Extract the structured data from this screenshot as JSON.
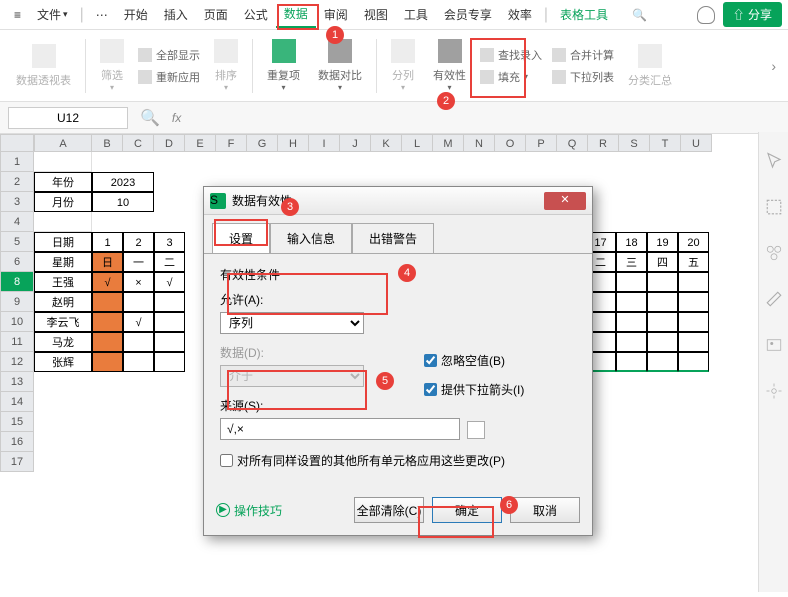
{
  "menubar": {
    "file": "文件",
    "items": [
      "开始",
      "插入",
      "页面",
      "公式",
      "数据",
      "审阅",
      "视图",
      "工具",
      "会员专享",
      "效率"
    ],
    "active_index": 4,
    "tools_label": "表格工具",
    "share": "分享"
  },
  "ribbon": {
    "pivot": "数据透视表",
    "filter": "筛选",
    "show_all": "全部显示",
    "reapply": "重新应用",
    "sort": "排序",
    "dup": "重复项",
    "compare": "数据对比",
    "split": "分列",
    "validity": "有效性",
    "fill": "填充",
    "find_input": "查找录入",
    "drop_list": "下拉列表",
    "consolidate": "合并计算",
    "cat_sum": "分类汇总"
  },
  "refbar": {
    "cell": "U12",
    "fx": "fx"
  },
  "columns": [
    "A",
    "B",
    "C",
    "D",
    "E",
    "F",
    "G",
    "H",
    "I",
    "J",
    "K",
    "L",
    "M",
    "N",
    "O",
    "P",
    "Q",
    "R",
    "S",
    "T",
    "U"
  ],
  "data_cols_right": [
    "17",
    "18",
    "19",
    "20"
  ],
  "weekday_right": [
    "二",
    "三",
    "四",
    "五"
  ],
  "sheet": {
    "r2": {
      "label": "年份",
      "value": "2023"
    },
    "r3": {
      "label": "月份",
      "value": "10"
    },
    "r5": {
      "label": "日期",
      "vals": [
        "1",
        "2",
        "3"
      ]
    },
    "r6": {
      "label": "星期",
      "vals": [
        "日",
        "一",
        "二"
      ]
    },
    "r8": {
      "label": "王强",
      "vals": [
        "√",
        "×",
        "√"
      ]
    },
    "r9": {
      "label": "赵明",
      "vals": [
        "",
        "",
        ""
      ]
    },
    "r10": {
      "label": "李云飞",
      "vals": [
        "",
        "√",
        ""
      ]
    },
    "r11": {
      "label": "马龙",
      "vals": [
        "",
        "",
        ""
      ]
    },
    "r12": {
      "label": "张辉",
      "vals": [
        "",
        "",
        ""
      ]
    }
  },
  "dialog": {
    "title": "数据有效性",
    "tabs": [
      "设置",
      "输入信息",
      "出错警告"
    ],
    "active_tab": 0,
    "section": "有效性条件",
    "allow_label": "允许(A):",
    "allow_value": "序列",
    "data_label": "数据(D):",
    "data_value": "介于",
    "source_label": "来源(S):",
    "source_value": "√,×",
    "ignore_blank": "忽略空值(B)",
    "dropdown_arrow": "提供下拉箭头(I)",
    "apply_all": "对所有同样设置的其他所有单元格应用这些更改(P)",
    "tip": "操作技巧",
    "btn_clear": "全部清除(C)",
    "btn_ok": "确定",
    "btn_cancel": "取消"
  },
  "callouts": {
    "c1": "1",
    "c2": "2",
    "c3": "3",
    "c4": "4",
    "c5": "5",
    "c6": "6"
  }
}
